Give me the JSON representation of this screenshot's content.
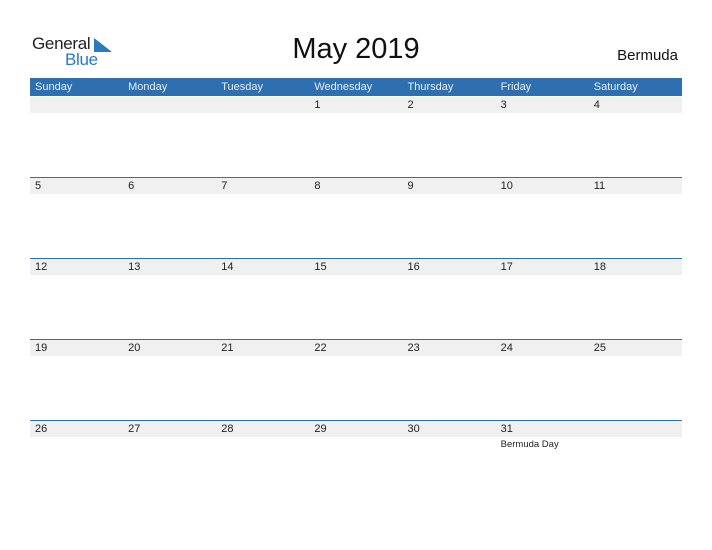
{
  "logo": {
    "general": "General",
    "blue": "Blue",
    "icon": "triangle-flag-icon"
  },
  "title": "May 2019",
  "country": "Bermuda",
  "colors": {
    "accent": "#2e6fb0",
    "strip": "#f0f0f0",
    "logo_blue": "#2a7ac0"
  },
  "days_of_week": [
    "Sunday",
    "Monday",
    "Tuesday",
    "Wednesday",
    "Thursday",
    "Friday",
    "Saturday"
  ],
  "weeks": [
    [
      {
        "day": ""
      },
      {
        "day": ""
      },
      {
        "day": ""
      },
      {
        "day": "1"
      },
      {
        "day": "2"
      },
      {
        "day": "3"
      },
      {
        "day": "4"
      }
    ],
    [
      {
        "day": "5"
      },
      {
        "day": "6"
      },
      {
        "day": "7"
      },
      {
        "day": "8"
      },
      {
        "day": "9"
      },
      {
        "day": "10"
      },
      {
        "day": "11"
      }
    ],
    [
      {
        "day": "12"
      },
      {
        "day": "13"
      },
      {
        "day": "14"
      },
      {
        "day": "15"
      },
      {
        "day": "16"
      },
      {
        "day": "17"
      },
      {
        "day": "18"
      }
    ],
    [
      {
        "day": "19"
      },
      {
        "day": "20"
      },
      {
        "day": "21"
      },
      {
        "day": "22"
      },
      {
        "day": "23"
      },
      {
        "day": "24"
      },
      {
        "day": "25"
      }
    ],
    [
      {
        "day": "26"
      },
      {
        "day": "27"
      },
      {
        "day": "28"
      },
      {
        "day": "29"
      },
      {
        "day": "30"
      },
      {
        "day": "31",
        "holiday": "Bermuda Day"
      },
      {
        "day": ""
      }
    ]
  ]
}
